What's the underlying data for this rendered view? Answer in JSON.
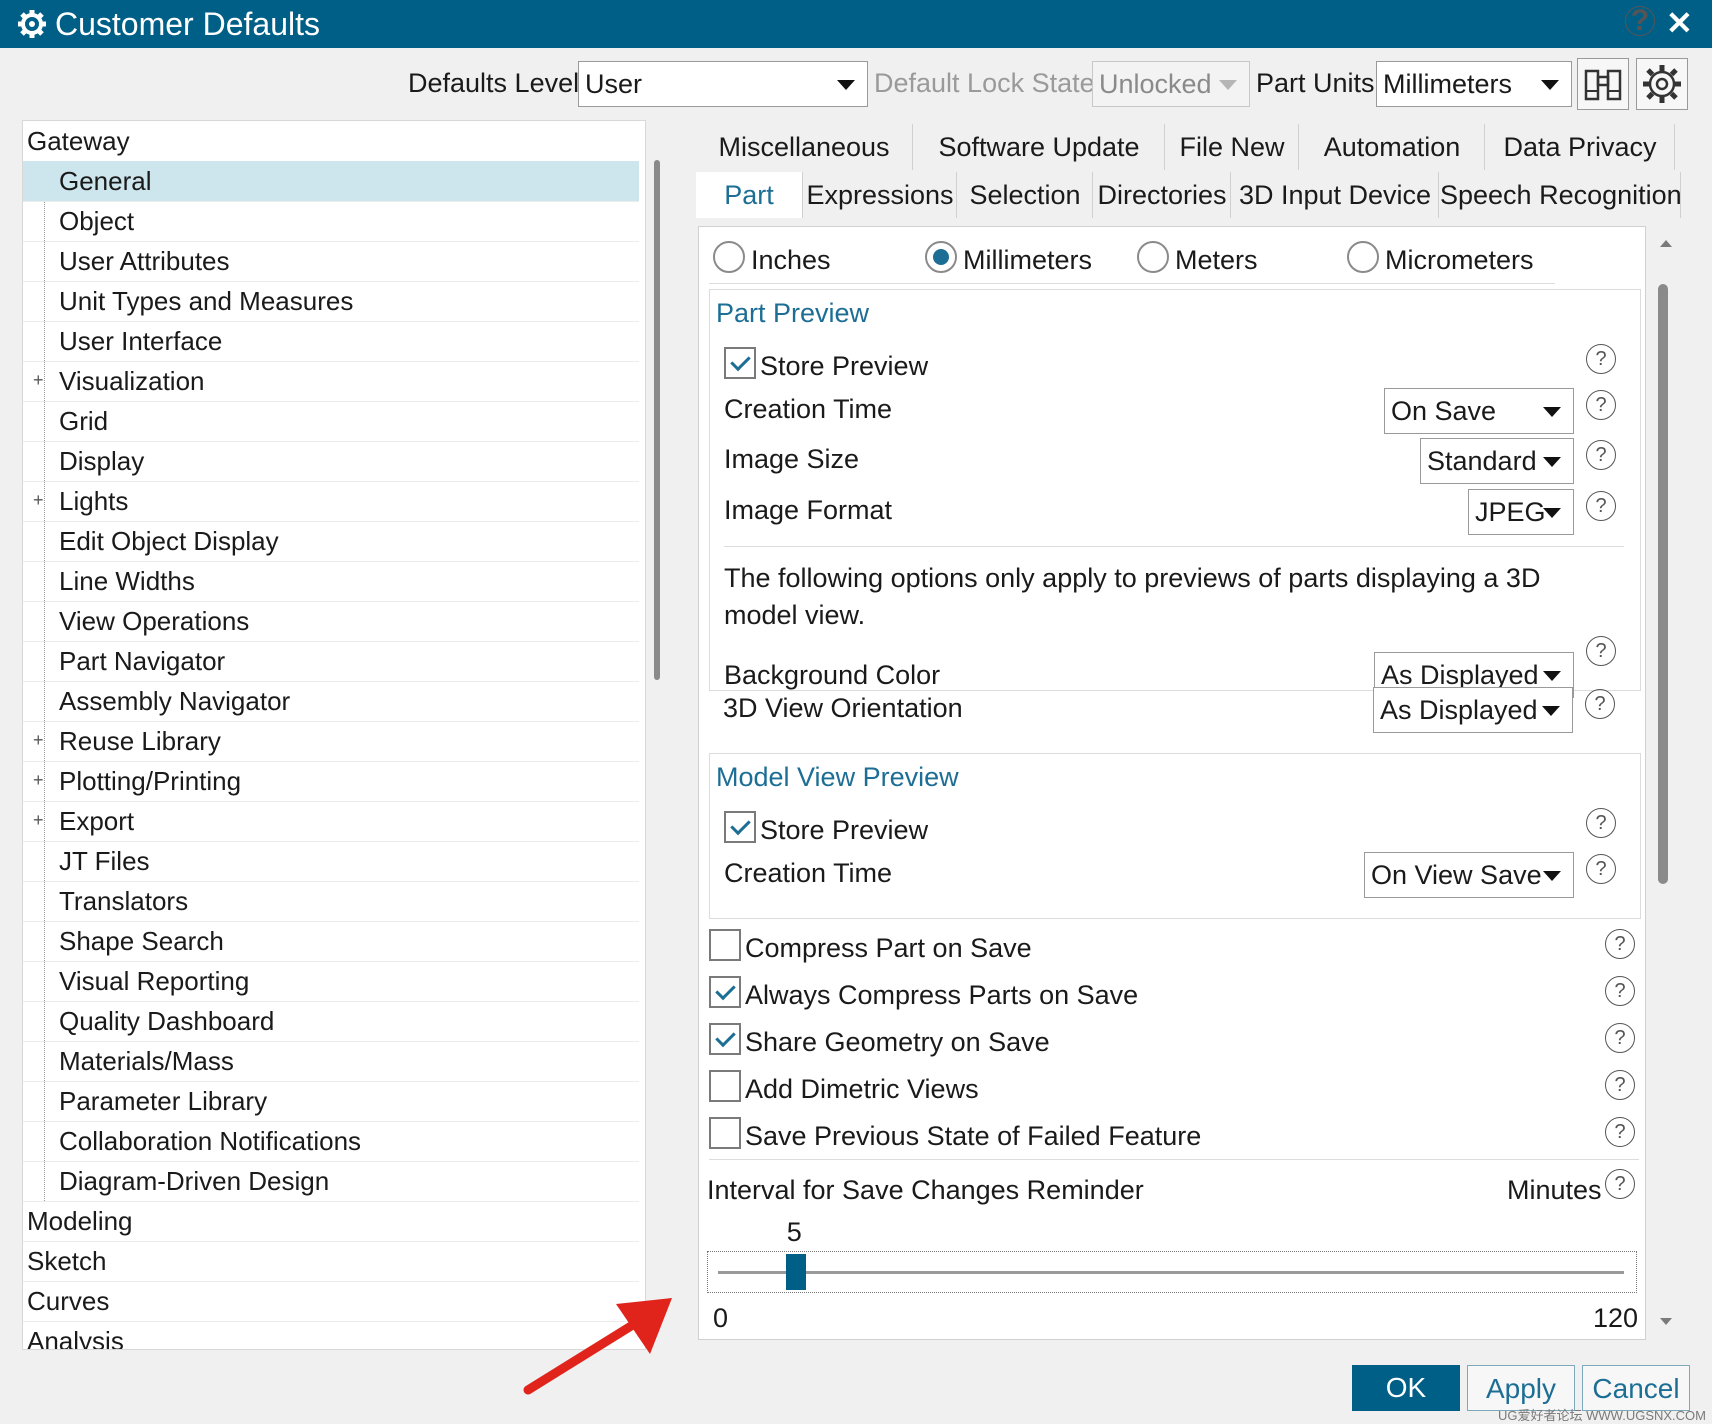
{
  "window": {
    "title": "Customer Defaults",
    "help": "?",
    "close": "✕"
  },
  "toolbar": {
    "defaults_level_label": "Defaults Level",
    "defaults_level_value": "User",
    "lock_state_label": "Default Lock State",
    "lock_state_value": "Unlocked",
    "part_units_label": "Part Units",
    "part_units_value": "Millimeters"
  },
  "tree": {
    "items": [
      {
        "label": "Gateway",
        "level": 0
      },
      {
        "label": "General",
        "level": 1,
        "selected": true
      },
      {
        "label": "Object",
        "level": 1
      },
      {
        "label": "User Attributes",
        "level": 1
      },
      {
        "label": "Unit Types and Measures",
        "level": 1
      },
      {
        "label": "User Interface",
        "level": 1
      },
      {
        "label": "Visualization",
        "level": 1,
        "expandable": true
      },
      {
        "label": "Grid",
        "level": 1
      },
      {
        "label": "Display",
        "level": 1
      },
      {
        "label": "Lights",
        "level": 1,
        "expandable": true
      },
      {
        "label": "Edit Object Display",
        "level": 1
      },
      {
        "label": "Line Widths",
        "level": 1
      },
      {
        "label": "View Operations",
        "level": 1
      },
      {
        "label": "Part Navigator",
        "level": 1
      },
      {
        "label": "Assembly Navigator",
        "level": 1
      },
      {
        "label": "Reuse Library",
        "level": 1,
        "expandable": true
      },
      {
        "label": "Plotting/Printing",
        "level": 1,
        "expandable": true
      },
      {
        "label": "Export",
        "level": 1,
        "expandable": true
      },
      {
        "label": "JT Files",
        "level": 1
      },
      {
        "label": "Translators",
        "level": 1
      },
      {
        "label": "Shape Search",
        "level": 1
      },
      {
        "label": "Visual Reporting",
        "level": 1
      },
      {
        "label": "Quality Dashboard",
        "level": 1
      },
      {
        "label": "Materials/Mass",
        "level": 1
      },
      {
        "label": "Parameter Library",
        "level": 1
      },
      {
        "label": "Collaboration Notifications",
        "level": 1
      },
      {
        "label": "Diagram-Driven Design",
        "level": 1
      },
      {
        "label": "Modeling",
        "level": 0
      },
      {
        "label": "Sketch",
        "level": 0
      },
      {
        "label": "Curves",
        "level": 0
      },
      {
        "label": "Analysis",
        "level": 0
      }
    ]
  },
  "tabs_row1": [
    "Miscellaneous",
    "Software Update",
    "File New",
    "Automation",
    "Data Privacy"
  ],
  "tabs_row2": [
    "Part",
    "Expressions",
    "Selection",
    "Directories",
    "3D Input Device",
    "Speech Recognition"
  ],
  "active_tab": "Part",
  "units": {
    "options": [
      "Inches",
      "Millimeters",
      "Meters",
      "Micrometers"
    ],
    "selected": "Millimeters"
  },
  "part_preview": {
    "title": "Part Preview",
    "store_preview": "Store Preview",
    "store_preview_checked": true,
    "creation_time_label": "Creation Time",
    "creation_time_value": "On Save",
    "image_size_label": "Image Size",
    "image_size_value": "Standard",
    "image_format_label": "Image Format",
    "image_format_value": "JPEG",
    "note": "The following options only apply to previews of parts displaying a 3D model view.",
    "bg_color_label": "Background Color",
    "bg_color_value": "As Displayed",
    "orientation_label": "3D View Orientation",
    "orientation_value": "As Displayed"
  },
  "model_view_preview": {
    "title": "Model View Preview",
    "store_preview": "Store Preview",
    "store_preview_checked": true,
    "creation_time_label": "Creation Time",
    "creation_time_value": "On View Save"
  },
  "options": [
    {
      "label": "Compress Part on Save",
      "checked": false
    },
    {
      "label": "Always Compress Parts on Save",
      "checked": true
    },
    {
      "label": "Share Geometry on Save",
      "checked": true
    },
    {
      "label": "Add Dimetric Views",
      "checked": false
    },
    {
      "label": "Save Previous State of Failed Feature",
      "checked": false
    }
  ],
  "reminder": {
    "label": "Interval for Save Changes Reminder",
    "unit": "Minutes",
    "value": 5,
    "value_text": "5",
    "min": 0,
    "max": 120,
    "min_text": "0",
    "max_text": "120"
  },
  "buttons": {
    "ok": "OK",
    "apply": "Apply",
    "cancel": "Cancel"
  },
  "watermark": "UG爱好者论坛 WWW.UGSNX.COM",
  "colors": {
    "titlebar": "#005f87",
    "accent": "#1d6e95",
    "selected_row": "#cde5ec",
    "arrow": "#e0241c"
  }
}
